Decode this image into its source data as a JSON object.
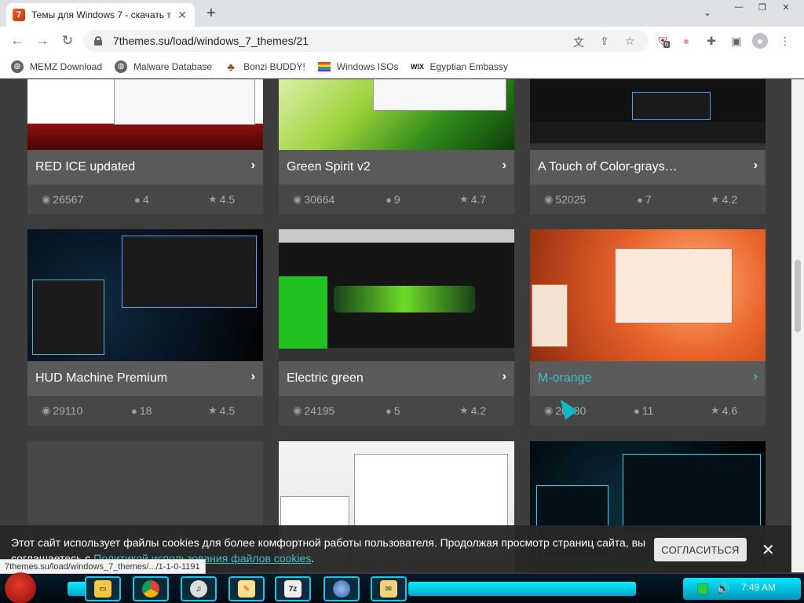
{
  "browser": {
    "tab_title": "Темы для Windows 7 - скачать т",
    "favicon_text": "7",
    "url": "7themes.su/load/windows_7_themes/21",
    "extension_badge": "6",
    "status_url": "7themes.su/load/windows_7_themes/.../1-1-0-1191"
  },
  "bookmarks": [
    {
      "label": "MEMZ Download",
      "icon": "globe-icon"
    },
    {
      "label": "Malware Database",
      "icon": "globe-icon"
    },
    {
      "label": "Bonzi BUDDY!",
      "icon": "bonzi-icon"
    },
    {
      "label": "Windows ISOs",
      "icon": "rainbow-flag-icon"
    },
    {
      "label": "Egyptian Embassy",
      "icon": "wix-icon",
      "icon_text": "WIX"
    }
  ],
  "cards": [
    {
      "title": "RED ICE updated",
      "views": "26567",
      "comments": "4",
      "rating": "4.5"
    },
    {
      "title": "Green Spirit v2",
      "views": "30664",
      "comments": "9",
      "rating": "4.7"
    },
    {
      "title": "A Touch of Color-grays…",
      "views": "52025",
      "comments": "7",
      "rating": "4.2"
    },
    {
      "title": "HUD Machine Premium",
      "views": "29110",
      "comments": "18",
      "rating": "4.5"
    },
    {
      "title": "Electric green",
      "views": "24195",
      "comments": "5",
      "rating": "4.2"
    },
    {
      "title": "M-orange",
      "views": "20330",
      "comments": "11",
      "rating": "4.6"
    }
  ],
  "cookie": {
    "text": "Этот сайт использует файлы cookies для более комфортной работы пользователя. Продолжая просмотр страниц сайта, вы соглашаетесь с ",
    "link": "Политикой использования файлов cookies",
    "tail": ".",
    "accept_label": "СОГЛАСИТЬСЯ",
    "close_label": "✕"
  },
  "taskbar": {
    "clock": "7:49 AM",
    "apps": [
      "explorer",
      "chrome",
      "media-player",
      "paint",
      "winrar",
      "media-center",
      "notepad"
    ]
  },
  "colors": {
    "accent": "#3fc0c6",
    "card_title_bg": "#5a5a5a",
    "card_stats_bg": "#474747",
    "page_bg": "#3d3d3d"
  }
}
